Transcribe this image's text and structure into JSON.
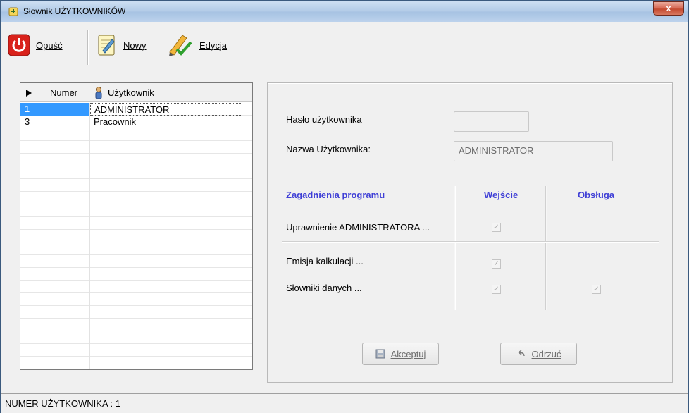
{
  "window": {
    "title": "Słownik UŻYTKOWNIKÓW",
    "close_label": "x"
  },
  "toolbar": {
    "exit_label": "Opuść",
    "new_label": "Nowy",
    "edit_label": "Edycja"
  },
  "grid": {
    "columns": [
      "Numer",
      "Użytkownik"
    ],
    "rows": [
      {
        "number": "1",
        "user": "ADMINISTRATOR"
      },
      {
        "number": "3",
        "user": "Pracownik"
      }
    ]
  },
  "form": {
    "password_label": "Hasło użytkownika",
    "password_value": "",
    "username_label": "Nazwa Użytkownika:",
    "username_value": "ADMINISTRATOR"
  },
  "permissions": {
    "headers": {
      "topics": "Zagadnienia programu",
      "entry": "Wejście",
      "service": "Obsługa"
    },
    "rows": [
      {
        "label": "Uprawnienie ADMINISTRATORA ...",
        "entry": true,
        "service": false
      },
      {
        "label": "Emisja kalkulacji ...",
        "entry": true,
        "service": false
      },
      {
        "label": "Słowniki danych ...",
        "entry": true,
        "service": true
      }
    ]
  },
  "buttons": {
    "accept_label": "Akceptuj",
    "reject_label": "Odrzuć"
  },
  "status": {
    "text": "NUMER UŻYTKOWNIKA :  1"
  },
  "colors": {
    "header_blue": "#3f3fd6",
    "selection": "#3399ff"
  }
}
